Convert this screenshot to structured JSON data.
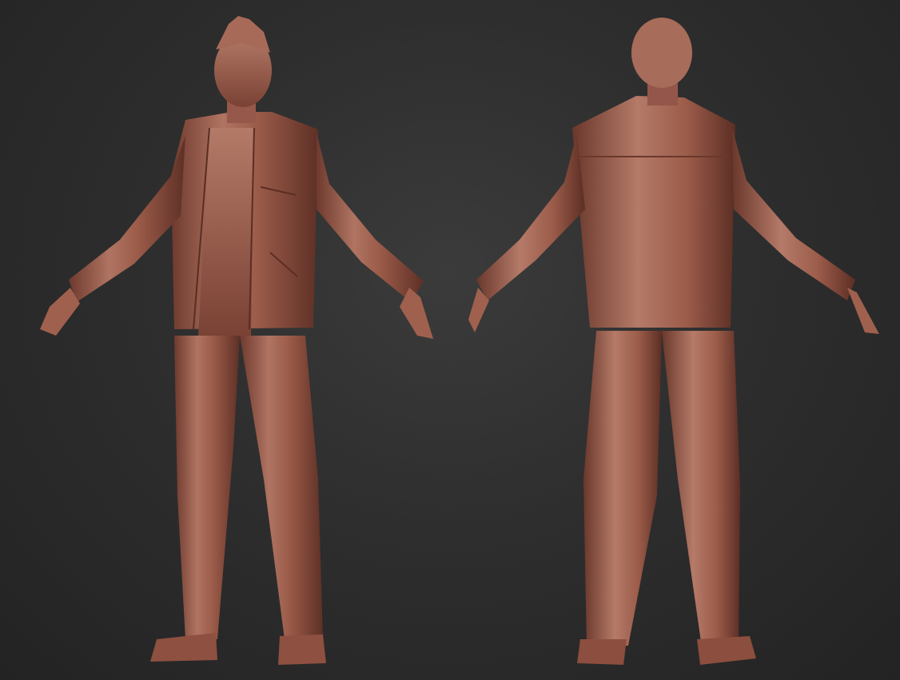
{
  "scene": {
    "background_color": "#2e2e2e",
    "material_color": "#9a5a48",
    "material_highlight": "#c88a76",
    "material_shadow": "#5a2e24",
    "views": [
      {
        "id": "front",
        "description_icon": "sculpt-figure-front"
      },
      {
        "id": "back",
        "description_icon": "sculpt-figure-back"
      }
    ]
  }
}
